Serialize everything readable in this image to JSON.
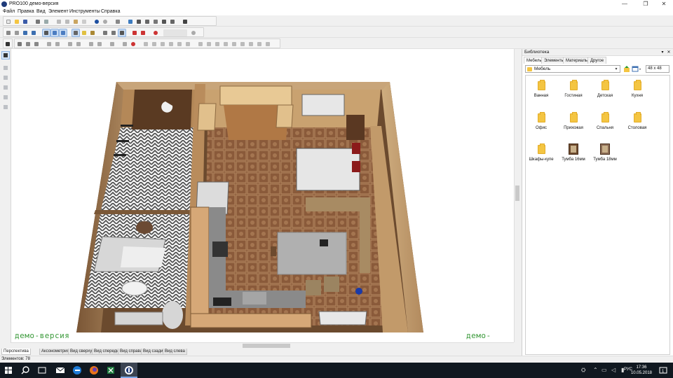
{
  "window": {
    "title": "PRO100 демо-версия",
    "controls": [
      "—",
      "❐",
      "✕"
    ]
  },
  "menu": [
    "Файл",
    "Правка",
    "Вид",
    "Элемент",
    "Инструменты",
    "Справка"
  ],
  "viewport": {
    "watermark_left": "демо-версия",
    "watermark_right": "демо-версия"
  },
  "view_tabs": [
    "Перспектива",
    "Аксонометрия",
    "Вид сверху",
    "Вид спереди",
    "Вид справа",
    "Вид сзади",
    "Вид слева"
  ],
  "active_view_tab": "Перспектива",
  "status": {
    "elements": "Элементов: 78"
  },
  "library": {
    "title": "Библиотека",
    "tabs": [
      "Мебель",
      "Элементы",
      "Материалы",
      "Другое"
    ],
    "active_tab": "Мебель",
    "current_folder": "Мебель",
    "icon_size": "48 x 48",
    "items": [
      {
        "label": "Ванная",
        "icon": "folder-icon"
      },
      {
        "label": "Гостиная",
        "icon": "folder-icon"
      },
      {
        "label": "Детская",
        "icon": "folder-icon"
      },
      {
        "label": "Кухня",
        "icon": "folder-icon"
      },
      {
        "label": "Офис",
        "icon": "folder-icon"
      },
      {
        "label": "Прихожая",
        "icon": "folder-icon"
      },
      {
        "label": "Спальня",
        "icon": "folder-icon"
      },
      {
        "label": "Столовая",
        "icon": "folder-icon"
      },
      {
        "label": "Шкафы-купе",
        "icon": "folder-icon"
      },
      {
        "label": "Тумба 16мм",
        "icon": "cabinet-icon"
      },
      {
        "label": "Тумба 18мм",
        "icon": "cabinet-icon"
      }
    ]
  },
  "taskbar": {
    "time": "17:36",
    "date": "10.05.2018",
    "lang": "РУС"
  }
}
